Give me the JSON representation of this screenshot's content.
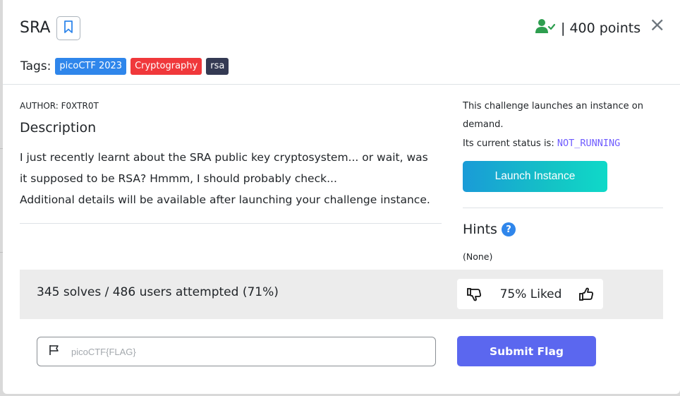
{
  "challenge": {
    "title": "SRA",
    "points_label": "| 400 points",
    "close_glyph": "×",
    "tags_label": "Tags:",
    "tags": [
      {
        "label": "picoCTF 2023",
        "color": "#2f86eb"
      },
      {
        "label": "Cryptography",
        "color": "#f0383b"
      },
      {
        "label": "rsa",
        "color": "#343a53"
      }
    ],
    "author": "AUTHOR: F0XTR0T",
    "description_heading": "Description",
    "description_lines": [
      "I just recently learnt about the SRA public key cryptosystem... or wait, was it supposed to be RSA? Hmmm, I should probably check...",
      "Additional details will be available after launching your challenge instance."
    ]
  },
  "instance": {
    "text1": "This challenge launches an instance on demand.",
    "status_prefix": "Its current status is:",
    "status_value": "NOT_RUNNING",
    "launch_label": "Launch Instance"
  },
  "hints": {
    "heading": "Hints",
    "help_glyph": "?",
    "value": "(None)"
  },
  "stats": {
    "solves_text": "345 solves / 486 users attempted (71%)",
    "liked_text": "75% Liked"
  },
  "flag": {
    "placeholder": "picoCTF{FLAG}",
    "submit_label": "Submit Flag"
  },
  "icons": {
    "bookmark": "bookmark-icon",
    "solved": "user-check-icon",
    "close": "close-icon",
    "help": "question-circle-icon",
    "dislike": "thumbs-down-icon",
    "like": "thumbs-up-icon",
    "flag": "flag-icon"
  },
  "colors": {
    "accent": "#5b67ef",
    "solved_green": "#2e9e4f",
    "status_purple": "#6f5cff"
  }
}
